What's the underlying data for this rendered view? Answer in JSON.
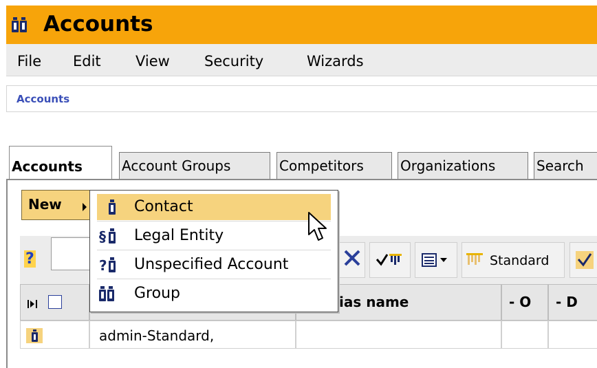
{
  "window": {
    "title": "Accounts",
    "icon": "accounts-icon"
  },
  "menu": [
    "File",
    "Edit",
    "View",
    "Security",
    "Wizards"
  ],
  "breadcrumb": "Accounts",
  "tabs": [
    "Accounts",
    "Account Groups",
    "Competitors",
    "Organizations",
    "Search"
  ],
  "new_button": {
    "label": "New"
  },
  "dropdown": {
    "items": [
      {
        "label": "Contact",
        "icon": "contact-icon",
        "highlighted": true
      },
      {
        "label": "Legal Entity",
        "icon": "legal-entity-icon"
      },
      {
        "label": "Unspecified Account",
        "icon": "unspecified-account-icon"
      },
      {
        "label": "Group",
        "icon": "group-icon"
      }
    ]
  },
  "toolbar": {
    "help": "?",
    "standard_label": "Standard"
  },
  "grid": {
    "headers": {
      "alias": "ias name",
      "col_o": "O",
      "col_d": "D"
    },
    "rows": [
      {
        "name": "admin-Standard,"
      }
    ]
  },
  "colors": {
    "titlebar": "#f7a40a",
    "highlight": "#f6d37e",
    "link": "#3a4fb8"
  }
}
